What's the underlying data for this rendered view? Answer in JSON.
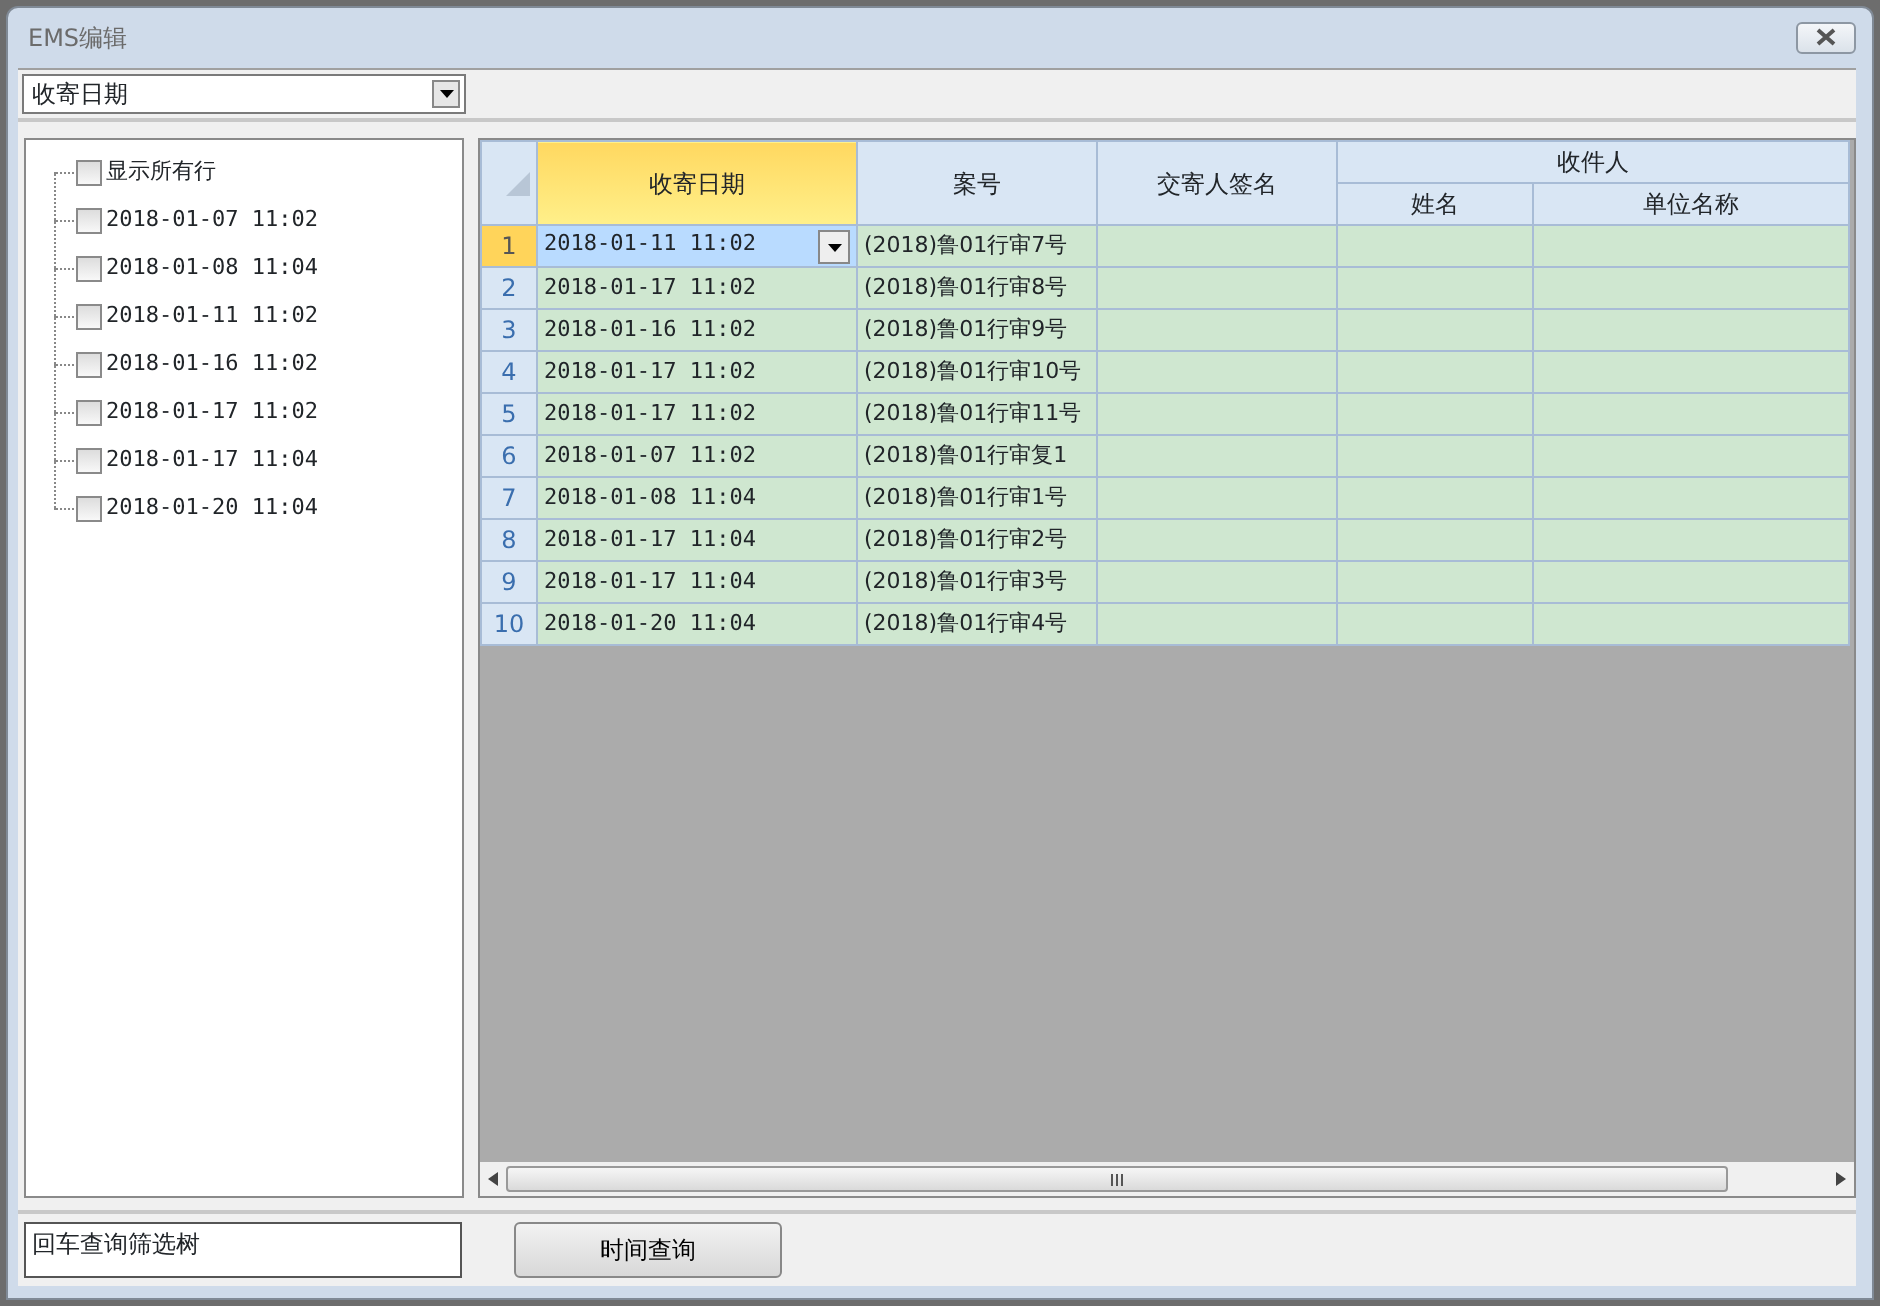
{
  "window": {
    "title": "EMS编辑"
  },
  "filter_combo": {
    "value": "收寄日期"
  },
  "tree": [
    {
      "label": "显示所有行",
      "checked": false
    },
    {
      "label": "2018-01-07 11:02",
      "checked": false
    },
    {
      "label": "2018-01-08 11:04",
      "checked": false
    },
    {
      "label": "2018-01-11 11:02",
      "checked": false
    },
    {
      "label": "2018-01-16 11:02",
      "checked": false
    },
    {
      "label": "2018-01-17 11:02",
      "checked": false
    },
    {
      "label": "2018-01-17 11:04",
      "checked": false
    },
    {
      "label": "2018-01-20 11:04",
      "checked": false
    }
  ],
  "grid": {
    "columns": [
      {
        "label": "收寄日期",
        "selected": true
      },
      {
        "label": "案号",
        "selected": false
      },
      {
        "label": "交寄人签名",
        "selected": false
      },
      {
        "label": "收件人",
        "children": [
          "姓名",
          "单位名称"
        ]
      }
    ],
    "rows": [
      {
        "number": "1",
        "date": "2018-01-11 11:02",
        "case": "(2018)鲁01行审7号",
        "selected": true
      },
      {
        "number": "2",
        "date": "2018-01-17 11:02",
        "case": "(2018)鲁01行审8号",
        "selected": false
      },
      {
        "number": "3",
        "date": "2018-01-16 11:02",
        "case": "(2018)鲁01行审9号",
        "selected": false
      },
      {
        "number": "4",
        "date": "2018-01-17 11:02",
        "case": "(2018)鲁01行审10号",
        "selected": false
      },
      {
        "number": "5",
        "date": "2018-01-17 11:02",
        "case": "(2018)鲁01行审11号",
        "selected": false
      },
      {
        "number": "6",
        "date": "2018-01-07 11:02",
        "case": "(2018)鲁01行审复1",
        "selected": false
      },
      {
        "number": "7",
        "date": "2018-01-08 11:04",
        "case": "(2018)鲁01行审1号",
        "selected": false
      },
      {
        "number": "8",
        "date": "2018-01-17 11:04",
        "case": "(2018)鲁01行审2号",
        "selected": false
      },
      {
        "number": "9",
        "date": "2018-01-17 11:04",
        "case": "(2018)鲁01行审3号",
        "selected": false
      },
      {
        "number": "10",
        "date": "2018-01-20 11:04",
        "case": "(2018)鲁01行审4号",
        "selected": false
      }
    ]
  },
  "tree_filter": {
    "value": "回车查询筛选树"
  },
  "buttons": [
    "时间查询"
  ]
}
